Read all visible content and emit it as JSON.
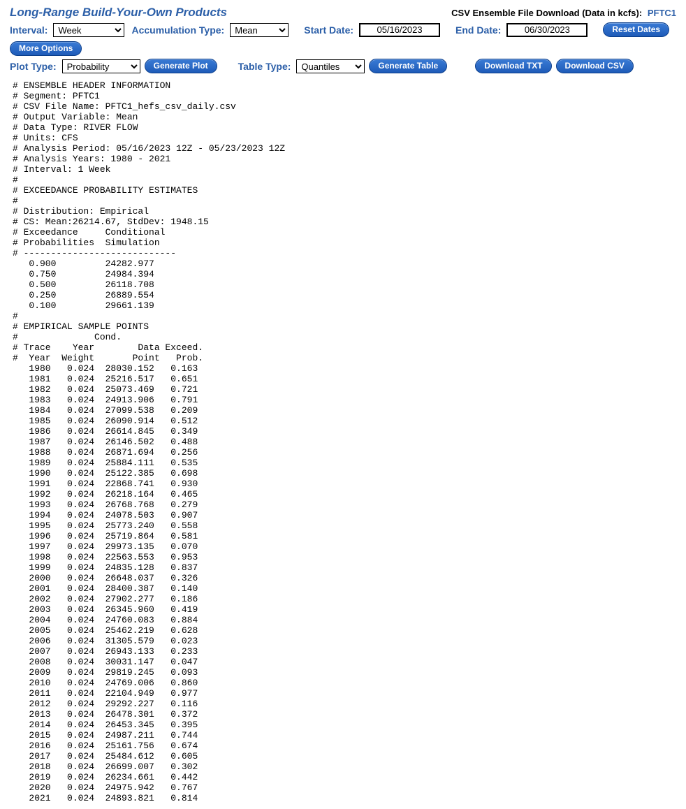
{
  "header": {
    "title": "Long-Range Build-Your-Own Products",
    "csv_text": "CSV Ensemble File Download (Data in kcfs):",
    "csv_link": "PFTC1"
  },
  "controls": {
    "interval_label": "Interval:",
    "interval_value": "Week",
    "accum_label": "Accumulation Type:",
    "accum_value": "Mean",
    "start_label": "Start Date:",
    "start_value": "05/16/2023",
    "end_label": "End Date:",
    "end_value": "06/30/2023",
    "reset_dates": "Reset Dates",
    "more_options": "More Options",
    "plot_label": "Plot Type:",
    "plot_value": "Probability",
    "gen_plot": "Generate Plot",
    "table_label": "Table Type:",
    "table_value": "Quantiles",
    "gen_table": "Generate Table",
    "dl_txt": "Download TXT",
    "dl_csv": "Download CSV"
  },
  "output": {
    "header_lines": [
      "# ENSEMBLE HEADER INFORMATION",
      "# Segment: PFTC1",
      "# CSV File Name: PFTC1_hefs_csv_daily.csv",
      "# Output Variable: Mean",
      "# Data Type: RIVER FLOW",
      "# Units: CFS",
      "# Analysis Period: 05/16/2023 12Z - 05/23/2023 12Z",
      "# Analysis Years: 1980 - 2021",
      "# Interval: 1 Week",
      "#",
      "# EXCEEDANCE PROBABILITY ESTIMATES",
      "#",
      "# Distribution: Empirical",
      "# CS: Mean:26214.67, StdDev: 1948.15",
      "# Exceedance     Conditional",
      "# Probabilities  Simulation",
      "# ----------------------------"
    ],
    "quantiles": [
      {
        "prob": "0.900",
        "value": "24282.977"
      },
      {
        "prob": "0.750",
        "value": "24984.394"
      },
      {
        "prob": "0.500",
        "value": "26118.708"
      },
      {
        "prob": "0.250",
        "value": "26889.554"
      },
      {
        "prob": "0.100",
        "value": "29661.139"
      }
    ],
    "sample_header_lines": [
      "#",
      "# EMPIRICAL SAMPLE POINTS",
      "#              Cond.",
      "# Trace    Year        Data Exceed.",
      "#  Year  Weight       Point   Prob."
    ],
    "sample_points": [
      {
        "year": "1980",
        "weight": "0.024",
        "data": "28030.152",
        "exceed": "0.163"
      },
      {
        "year": "1981",
        "weight": "0.024",
        "data": "25216.517",
        "exceed": "0.651"
      },
      {
        "year": "1982",
        "weight": "0.024",
        "data": "25073.469",
        "exceed": "0.721"
      },
      {
        "year": "1983",
        "weight": "0.024",
        "data": "24913.906",
        "exceed": "0.791"
      },
      {
        "year": "1984",
        "weight": "0.024",
        "data": "27099.538",
        "exceed": "0.209"
      },
      {
        "year": "1985",
        "weight": "0.024",
        "data": "26090.914",
        "exceed": "0.512"
      },
      {
        "year": "1986",
        "weight": "0.024",
        "data": "26614.845",
        "exceed": "0.349"
      },
      {
        "year": "1987",
        "weight": "0.024",
        "data": "26146.502",
        "exceed": "0.488"
      },
      {
        "year": "1988",
        "weight": "0.024",
        "data": "26871.694",
        "exceed": "0.256"
      },
      {
        "year": "1989",
        "weight": "0.024",
        "data": "25884.111",
        "exceed": "0.535"
      },
      {
        "year": "1990",
        "weight": "0.024",
        "data": "25122.385",
        "exceed": "0.698"
      },
      {
        "year": "1991",
        "weight": "0.024",
        "data": "22868.741",
        "exceed": "0.930"
      },
      {
        "year": "1992",
        "weight": "0.024",
        "data": "26218.164",
        "exceed": "0.465"
      },
      {
        "year": "1993",
        "weight": "0.024",
        "data": "26768.768",
        "exceed": "0.279"
      },
      {
        "year": "1994",
        "weight": "0.024",
        "data": "24078.503",
        "exceed": "0.907"
      },
      {
        "year": "1995",
        "weight": "0.024",
        "data": "25773.240",
        "exceed": "0.558"
      },
      {
        "year": "1996",
        "weight": "0.024",
        "data": "25719.864",
        "exceed": "0.581"
      },
      {
        "year": "1997",
        "weight": "0.024",
        "data": "29973.135",
        "exceed": "0.070"
      },
      {
        "year": "1998",
        "weight": "0.024",
        "data": "22563.553",
        "exceed": "0.953"
      },
      {
        "year": "1999",
        "weight": "0.024",
        "data": "24835.128",
        "exceed": "0.837"
      },
      {
        "year": "2000",
        "weight": "0.024",
        "data": "26648.037",
        "exceed": "0.326"
      },
      {
        "year": "2001",
        "weight": "0.024",
        "data": "28400.387",
        "exceed": "0.140"
      },
      {
        "year": "2002",
        "weight": "0.024",
        "data": "27902.277",
        "exceed": "0.186"
      },
      {
        "year": "2003",
        "weight": "0.024",
        "data": "26345.960",
        "exceed": "0.419"
      },
      {
        "year": "2004",
        "weight": "0.024",
        "data": "24760.083",
        "exceed": "0.884"
      },
      {
        "year": "2005",
        "weight": "0.024",
        "data": "25462.219",
        "exceed": "0.628"
      },
      {
        "year": "2006",
        "weight": "0.024",
        "data": "31305.579",
        "exceed": "0.023"
      },
      {
        "year": "2007",
        "weight": "0.024",
        "data": "26943.133",
        "exceed": "0.233"
      },
      {
        "year": "2008",
        "weight": "0.024",
        "data": "30031.147",
        "exceed": "0.047"
      },
      {
        "year": "2009",
        "weight": "0.024",
        "data": "29819.245",
        "exceed": "0.093"
      },
      {
        "year": "2010",
        "weight": "0.024",
        "data": "24769.006",
        "exceed": "0.860"
      },
      {
        "year": "2011",
        "weight": "0.024",
        "data": "22104.949",
        "exceed": "0.977"
      },
      {
        "year": "2012",
        "weight": "0.024",
        "data": "29292.227",
        "exceed": "0.116"
      },
      {
        "year": "2013",
        "weight": "0.024",
        "data": "26478.301",
        "exceed": "0.372"
      },
      {
        "year": "2014",
        "weight": "0.024",
        "data": "26453.345",
        "exceed": "0.395"
      },
      {
        "year": "2015",
        "weight": "0.024",
        "data": "24987.211",
        "exceed": "0.744"
      },
      {
        "year": "2016",
        "weight": "0.024",
        "data": "25161.756",
        "exceed": "0.674"
      },
      {
        "year": "2017",
        "weight": "0.024",
        "data": "25484.612",
        "exceed": "0.605"
      },
      {
        "year": "2018",
        "weight": "0.024",
        "data": "26699.007",
        "exceed": "0.302"
      },
      {
        "year": "2019",
        "weight": "0.024",
        "data": "26234.661",
        "exceed": "0.442"
      },
      {
        "year": "2020",
        "weight": "0.024",
        "data": "24975.942",
        "exceed": "0.767"
      },
      {
        "year": "2021",
        "weight": "0.024",
        "data": "24893.821",
        "exceed": "0.814"
      }
    ]
  }
}
